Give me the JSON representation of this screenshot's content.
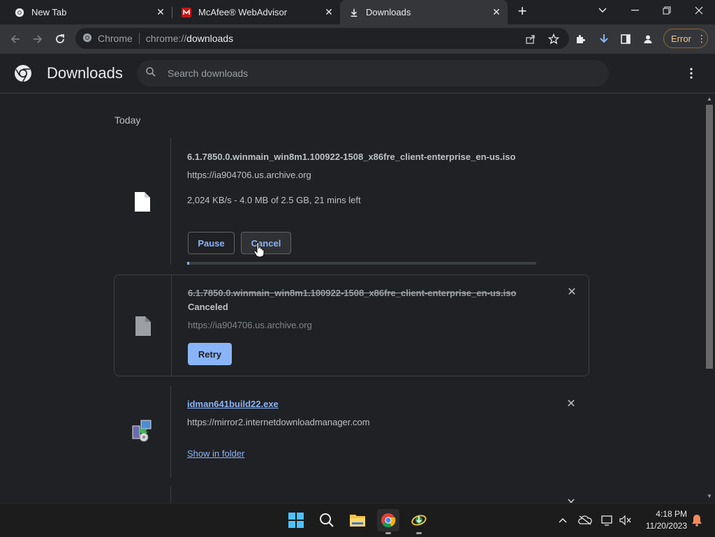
{
  "tabs": [
    {
      "title": "New Tab",
      "favicon": "chrome-icon"
    },
    {
      "title": "McAfee® WebAdvisor",
      "favicon": "mcafee-icon"
    },
    {
      "title": "Downloads",
      "favicon": "download-icon",
      "active": true
    }
  ],
  "omnibox": {
    "site_label": "Chrome",
    "url_scheme": "chrome://",
    "url_host": "downloads"
  },
  "toolbar": {
    "error_label": "Error"
  },
  "page": {
    "title": "Downloads",
    "search_placeholder": "Search downloads"
  },
  "downloads": {
    "date_header": "Today",
    "items": [
      {
        "filename": "6.1.7850.0.winmain_win8m1.100922-1508_x86fre_client-enterprise_en-us.iso",
        "source": "https://ia904706.us.archive.org",
        "status": "2,024 KB/s - 4.0 MB of 2.5 GB, 21 mins left",
        "progress_fraction": 0.0016,
        "pause_label": "Pause",
        "cancel_label": "Cancel"
      },
      {
        "filename": "6.1.7850.0.winmain_win8m1.100922-1508_x86fre_client-enterprise_en-us.iso",
        "state": "Canceled",
        "source": "https://ia904706.us.archive.org",
        "retry_label": "Retry"
      },
      {
        "filename": "idman641build22.exe",
        "source": "https://mirror2.internetdownloadmanager.com",
        "show_folder_label": "Show in folder"
      }
    ]
  },
  "taskbar": {
    "time": "4:18 PM",
    "date": "11/20/2023"
  },
  "colors": {
    "accent": "#8ab4f8",
    "background": "#202124",
    "error": "#f2c98a"
  }
}
